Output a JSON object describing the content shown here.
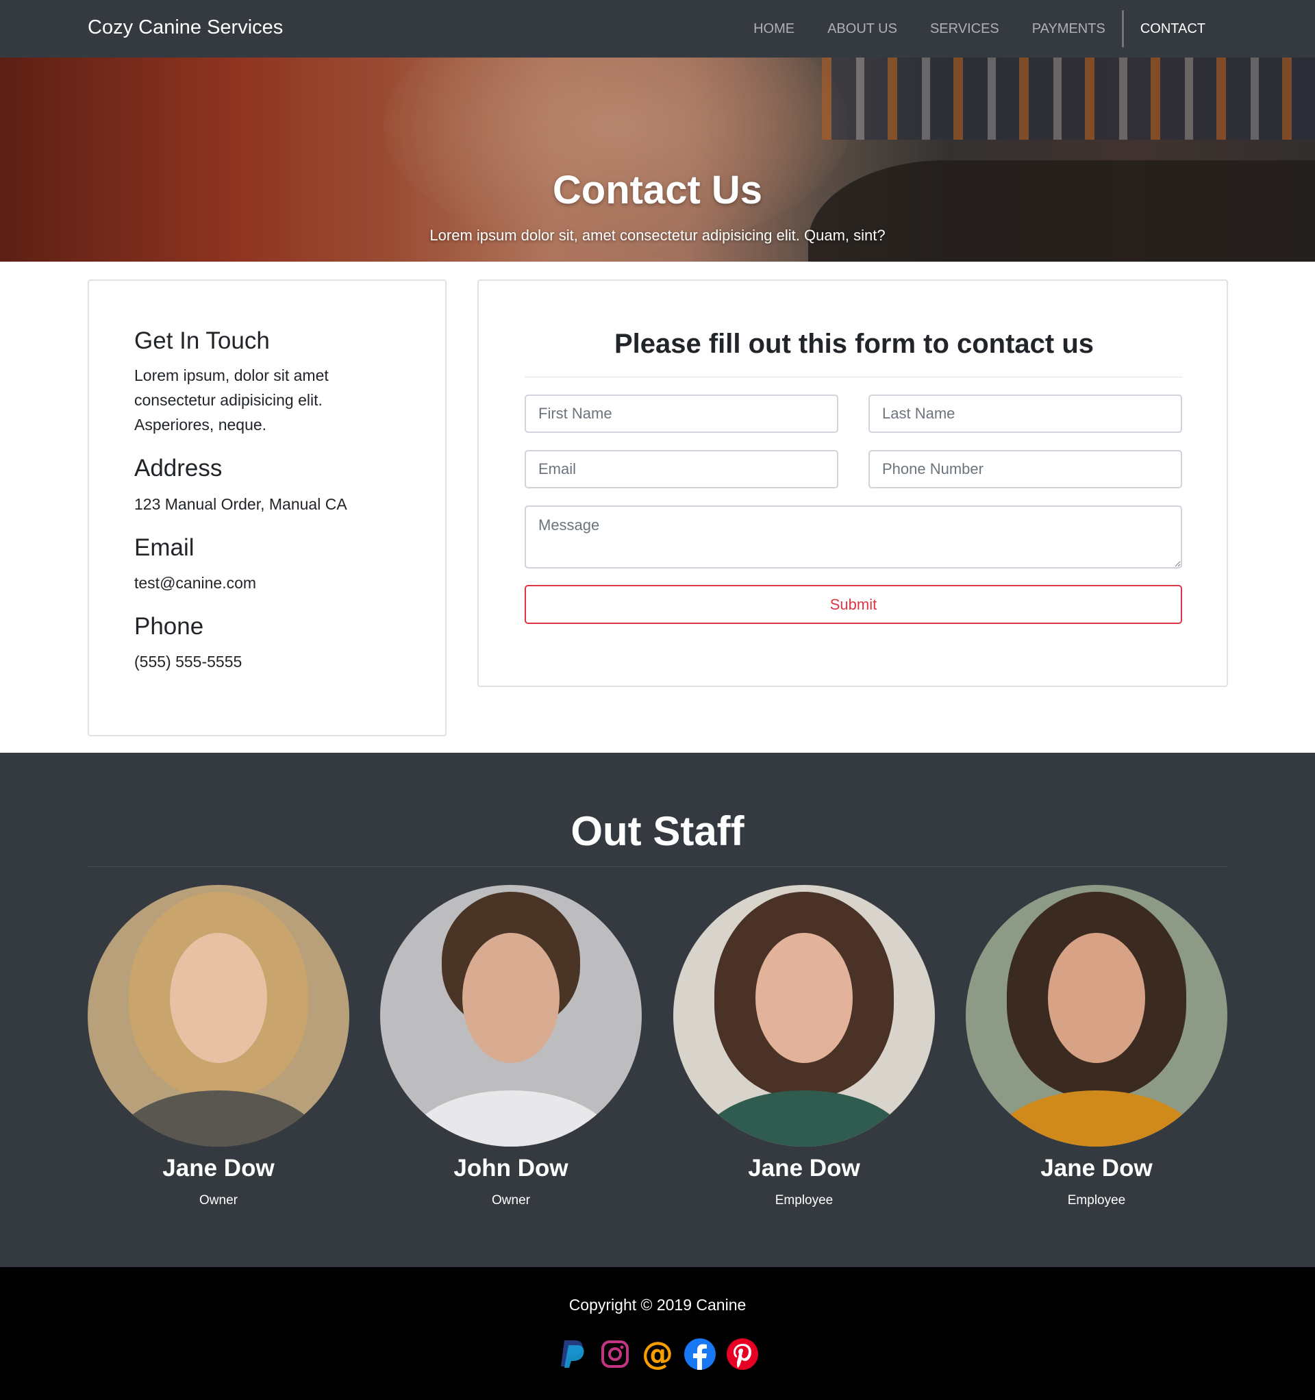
{
  "navbar": {
    "brand": "Cozy Canine Services",
    "items": [
      {
        "label": "HOME",
        "active": false
      },
      {
        "label": "ABOUT US",
        "active": false
      },
      {
        "label": "SERVICES",
        "active": false
      },
      {
        "label": "PAYMENTS",
        "active": false
      },
      {
        "label": "CONTACT",
        "active": true
      }
    ]
  },
  "hero": {
    "title": "Contact Us",
    "subtitle": "Lorem ipsum dolor sit, amet consectetur adipisicing elit. Quam, sint?"
  },
  "info": {
    "touch_heading": "Get In Touch",
    "touch_text": "Lorem ipsum, dolor sit amet consectetur adipisicing elit. Asperiores, neque.",
    "address_heading": "Address",
    "address": "123 Manual Order, Manual CA",
    "email_heading": "Email",
    "email": "test@canine.com",
    "phone_heading": "Phone",
    "phone": "(555) 555-5555"
  },
  "form": {
    "title": "Please fill out this form to contact us",
    "first_name_placeholder": "First Name",
    "last_name_placeholder": "Last Name",
    "email_placeholder": "Email",
    "phone_placeholder": "Phone Number",
    "message_placeholder": "Message",
    "submit_label": "Submit"
  },
  "staff": {
    "title": "Out Staff",
    "members": [
      {
        "name": "Jane Dow",
        "role": "Owner"
      },
      {
        "name": "John Dow",
        "role": "Owner"
      },
      {
        "name": "Jane Dow",
        "role": "Employee"
      },
      {
        "name": "Jane Dow",
        "role": "Employee"
      }
    ]
  },
  "footer": {
    "copyright": "Copyright © 2019 Canine",
    "socials": [
      "paypal-icon",
      "instagram-icon",
      "email-icon",
      "facebook-icon",
      "pinterest-icon"
    ]
  },
  "colors": {
    "navbar_bg": "#343a40",
    "accent_danger": "#dc3545",
    "footer_bg": "#000000"
  }
}
